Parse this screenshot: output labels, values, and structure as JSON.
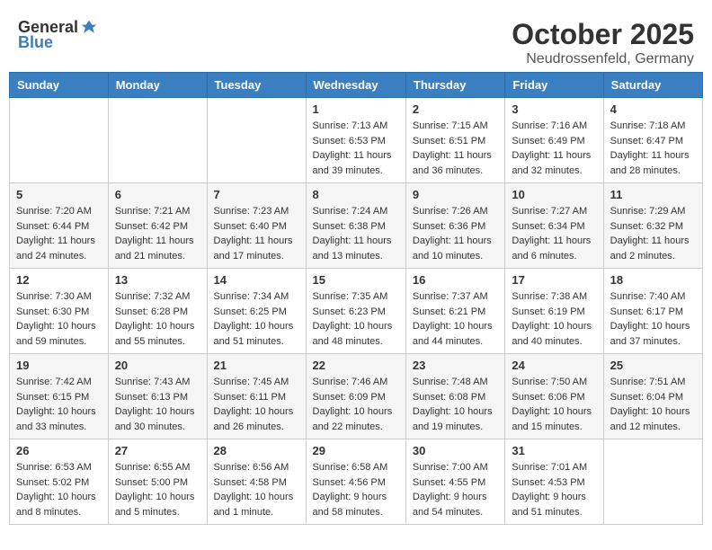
{
  "header": {
    "logo_general": "General",
    "logo_blue": "Blue",
    "month": "October 2025",
    "location": "Neudrossenfeld, Germany"
  },
  "weekdays": [
    "Sunday",
    "Monday",
    "Tuesday",
    "Wednesday",
    "Thursday",
    "Friday",
    "Saturday"
  ],
  "weeks": [
    [
      {
        "day": "",
        "info": ""
      },
      {
        "day": "",
        "info": ""
      },
      {
        "day": "",
        "info": ""
      },
      {
        "day": "1",
        "info": "Sunrise: 7:13 AM\nSunset: 6:53 PM\nDaylight: 11 hours\nand 39 minutes."
      },
      {
        "day": "2",
        "info": "Sunrise: 7:15 AM\nSunset: 6:51 PM\nDaylight: 11 hours\nand 36 minutes."
      },
      {
        "day": "3",
        "info": "Sunrise: 7:16 AM\nSunset: 6:49 PM\nDaylight: 11 hours\nand 32 minutes."
      },
      {
        "day": "4",
        "info": "Sunrise: 7:18 AM\nSunset: 6:47 PM\nDaylight: 11 hours\nand 28 minutes."
      }
    ],
    [
      {
        "day": "5",
        "info": "Sunrise: 7:20 AM\nSunset: 6:44 PM\nDaylight: 11 hours\nand 24 minutes."
      },
      {
        "day": "6",
        "info": "Sunrise: 7:21 AM\nSunset: 6:42 PM\nDaylight: 11 hours\nand 21 minutes."
      },
      {
        "day": "7",
        "info": "Sunrise: 7:23 AM\nSunset: 6:40 PM\nDaylight: 11 hours\nand 17 minutes."
      },
      {
        "day": "8",
        "info": "Sunrise: 7:24 AM\nSunset: 6:38 PM\nDaylight: 11 hours\nand 13 minutes."
      },
      {
        "day": "9",
        "info": "Sunrise: 7:26 AM\nSunset: 6:36 PM\nDaylight: 11 hours\nand 10 minutes."
      },
      {
        "day": "10",
        "info": "Sunrise: 7:27 AM\nSunset: 6:34 PM\nDaylight: 11 hours\nand 6 minutes."
      },
      {
        "day": "11",
        "info": "Sunrise: 7:29 AM\nSunset: 6:32 PM\nDaylight: 11 hours\nand 2 minutes."
      }
    ],
    [
      {
        "day": "12",
        "info": "Sunrise: 7:30 AM\nSunset: 6:30 PM\nDaylight: 10 hours\nand 59 minutes."
      },
      {
        "day": "13",
        "info": "Sunrise: 7:32 AM\nSunset: 6:28 PM\nDaylight: 10 hours\nand 55 minutes."
      },
      {
        "day": "14",
        "info": "Sunrise: 7:34 AM\nSunset: 6:25 PM\nDaylight: 10 hours\nand 51 minutes."
      },
      {
        "day": "15",
        "info": "Sunrise: 7:35 AM\nSunset: 6:23 PM\nDaylight: 10 hours\nand 48 minutes."
      },
      {
        "day": "16",
        "info": "Sunrise: 7:37 AM\nSunset: 6:21 PM\nDaylight: 10 hours\nand 44 minutes."
      },
      {
        "day": "17",
        "info": "Sunrise: 7:38 AM\nSunset: 6:19 PM\nDaylight: 10 hours\nand 40 minutes."
      },
      {
        "day": "18",
        "info": "Sunrise: 7:40 AM\nSunset: 6:17 PM\nDaylight: 10 hours\nand 37 minutes."
      }
    ],
    [
      {
        "day": "19",
        "info": "Sunrise: 7:42 AM\nSunset: 6:15 PM\nDaylight: 10 hours\nand 33 minutes."
      },
      {
        "day": "20",
        "info": "Sunrise: 7:43 AM\nSunset: 6:13 PM\nDaylight: 10 hours\nand 30 minutes."
      },
      {
        "day": "21",
        "info": "Sunrise: 7:45 AM\nSunset: 6:11 PM\nDaylight: 10 hours\nand 26 minutes."
      },
      {
        "day": "22",
        "info": "Sunrise: 7:46 AM\nSunset: 6:09 PM\nDaylight: 10 hours\nand 22 minutes."
      },
      {
        "day": "23",
        "info": "Sunrise: 7:48 AM\nSunset: 6:08 PM\nDaylight: 10 hours\nand 19 minutes."
      },
      {
        "day": "24",
        "info": "Sunrise: 7:50 AM\nSunset: 6:06 PM\nDaylight: 10 hours\nand 15 minutes."
      },
      {
        "day": "25",
        "info": "Sunrise: 7:51 AM\nSunset: 6:04 PM\nDaylight: 10 hours\nand 12 minutes."
      }
    ],
    [
      {
        "day": "26",
        "info": "Sunrise: 6:53 AM\nSunset: 5:02 PM\nDaylight: 10 hours\nand 8 minutes."
      },
      {
        "day": "27",
        "info": "Sunrise: 6:55 AM\nSunset: 5:00 PM\nDaylight: 10 hours\nand 5 minutes."
      },
      {
        "day": "28",
        "info": "Sunrise: 6:56 AM\nSunset: 4:58 PM\nDaylight: 10 hours\nand 1 minute."
      },
      {
        "day": "29",
        "info": "Sunrise: 6:58 AM\nSunset: 4:56 PM\nDaylight: 9 hours\nand 58 minutes."
      },
      {
        "day": "30",
        "info": "Sunrise: 7:00 AM\nSunset: 4:55 PM\nDaylight: 9 hours\nand 54 minutes."
      },
      {
        "day": "31",
        "info": "Sunrise: 7:01 AM\nSunset: 4:53 PM\nDaylight: 9 hours\nand 51 minutes."
      },
      {
        "day": "",
        "info": ""
      }
    ]
  ]
}
